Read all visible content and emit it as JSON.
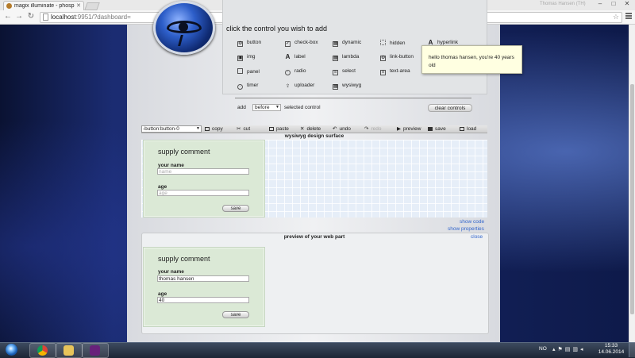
{
  "browser": {
    "tab_title": "magix illuminate - phosph",
    "profile_label": "Thomas Hansen (TH)",
    "url_host": "localhost",
    "url_rest": ":9951/?dashboard="
  },
  "palette": {
    "title": "click the control you wish to add",
    "controls": [
      {
        "label": "button",
        "icon": "gear-icon"
      },
      {
        "label": "check-box",
        "icon": "checkbox-icon"
      },
      {
        "label": "dynamic",
        "icon": "grid-icon"
      },
      {
        "label": "hidden",
        "icon": "hidden-icon"
      },
      {
        "label": "hyperlink",
        "icon": "font-icon"
      },
      {
        "label": "img",
        "icon": "image-icon"
      },
      {
        "label": "label",
        "icon": "font-icon"
      },
      {
        "label": "lambda",
        "icon": "grid-icon"
      },
      {
        "label": "link-button",
        "icon": "gear-icon"
      },
      {
        "label": "panel",
        "icon": "panel-icon"
      },
      {
        "label": "radio",
        "icon": "radio-icon"
      },
      {
        "label": "select",
        "icon": "select-icon"
      },
      {
        "label": "text-area",
        "icon": "textarea-icon"
      },
      {
        "label": "timer",
        "icon": "clock-icon"
      },
      {
        "label": "uploader",
        "icon": "upload-icon"
      },
      {
        "label": "wysiwyg",
        "icon": "grid-icon"
      }
    ],
    "add_label": "add",
    "position_value": "before",
    "selected_control_label": "selected control",
    "clear_label": "clear controls"
  },
  "tooltip": {
    "text": "hello thomas hansen, you're 40 years old"
  },
  "designer": {
    "component_value": "-button:button-0",
    "tools": {
      "copy": "copy",
      "cut": "cut",
      "paste": "paste",
      "delete": "delete",
      "undo": "undo",
      "redo": "redo",
      "preview": "preview",
      "save": "save",
      "load": "load"
    },
    "surface_title": "wysiwyg design surface",
    "widget": {
      "title": "supply comment",
      "name_label": "your name",
      "name_placeholder": "name",
      "age_label": "age",
      "age_placeholder": "age",
      "save_label": "save"
    },
    "show_code": "show code",
    "show_properties": "show properties"
  },
  "preview": {
    "title": "preview of your web part",
    "close": "close",
    "widget": {
      "title": "supply comment",
      "name_label": "your name",
      "name_value": "thomas hansen",
      "age_label": "age",
      "age_value": "40",
      "save_label": "save"
    }
  },
  "taskbar": {
    "lang": "NO",
    "time": "15:33",
    "date": "14.06.2014"
  }
}
